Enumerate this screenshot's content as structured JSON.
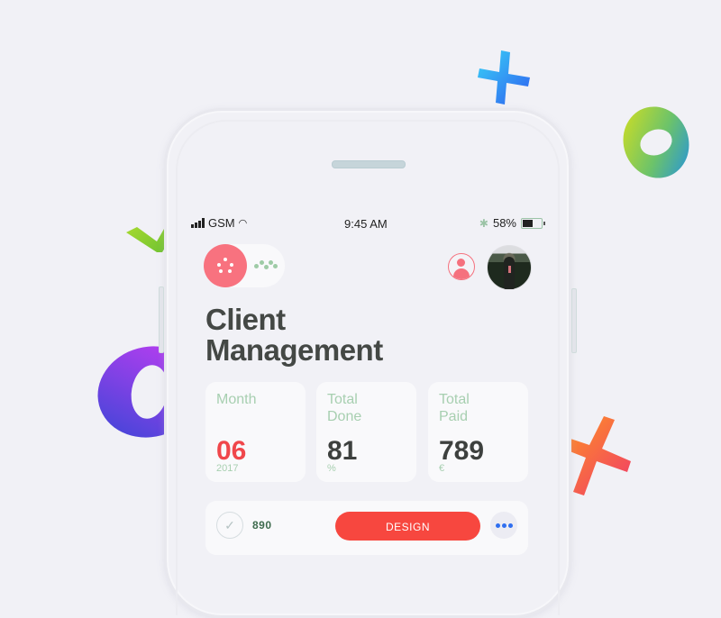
{
  "status_bar": {
    "carrier": "GSM",
    "time": "9:45 AM",
    "battery_percent": "58%",
    "battery_level": 0.58,
    "icons": [
      "signal-bars-icon",
      "wifi-icon",
      "bluetooth-icon",
      "battery-icon"
    ]
  },
  "header": {
    "toggle_state": "on",
    "toggle_left_icon": "dots-flower-icon",
    "toggle_right_icon": "dots-wave-icon",
    "profile_icon": "user-circle-icon",
    "avatar_alt": "user-avatar"
  },
  "page": {
    "title_line1": "Client",
    "title_line2": "Management"
  },
  "stats": [
    {
      "label_line1": "Month",
      "label_line2": "",
      "value": "06",
      "sub": "2017",
      "accent": "#f0474b"
    },
    {
      "label_line1": "Total",
      "label_line2": "Done",
      "value": "81",
      "sub": "%",
      "accent": "#3d403e"
    },
    {
      "label_line1": "Total",
      "label_line2": "Paid",
      "value": "789",
      "sub": "€",
      "accent": "#3d403e"
    }
  ],
  "task_row": {
    "number": "890",
    "tag_label": "DESIGN",
    "check_icon": "check-icon",
    "more_icon": "more-dots-icon"
  },
  "colors": {
    "background": "#f1f1f6",
    "accent_pink": "#f8727f",
    "accent_red": "#f7473f",
    "label_green": "#a7cfb0",
    "link_blue": "#2f6ff0"
  },
  "decorations": [
    "plus-3d-icon",
    "ring-green-3d-icon",
    "check-3d-icon",
    "ring-purple-3d-icon",
    "cross-3d-icon"
  ]
}
